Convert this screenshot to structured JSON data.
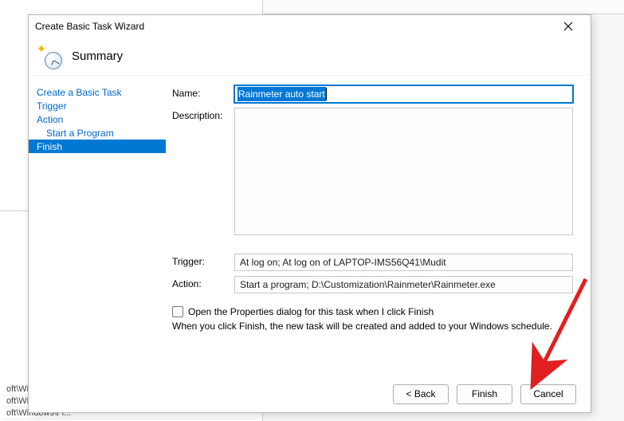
{
  "background": {
    "rows": [
      "oft\\Windo...",
      "oft\\Windows\\U...",
      "oft\\Windows\\Fl..."
    ]
  },
  "dialog": {
    "title": "Create Basic Task Wizard",
    "header": "Summary",
    "close_tooltip": "Close"
  },
  "sidebar": {
    "items": [
      {
        "label": "Create a Basic Task",
        "type": "link"
      },
      {
        "label": "Trigger",
        "type": "link"
      },
      {
        "label": "Action",
        "type": "link"
      },
      {
        "label": "Start a Program",
        "type": "link-indent"
      },
      {
        "label": "Finish",
        "type": "highlight"
      }
    ]
  },
  "form": {
    "name_label": "Name:",
    "name_value": "Rainmeter auto start",
    "desc_label": "Description:",
    "desc_value": "",
    "trigger_label": "Trigger:",
    "trigger_value": "At log on; At log on of LAPTOP-IMS56Q41\\Mudit",
    "action_label": "Action:",
    "action_value": "Start a program; D:\\Customization\\Rainmeter\\Rainmeter.exe",
    "open_props_label": "Open the Properties dialog for this task when I click Finish",
    "hint": "When you click Finish, the new task will be created and added to your Windows schedule."
  },
  "buttons": {
    "back": "< Back",
    "finish": "Finish",
    "cancel": "Cancel"
  }
}
